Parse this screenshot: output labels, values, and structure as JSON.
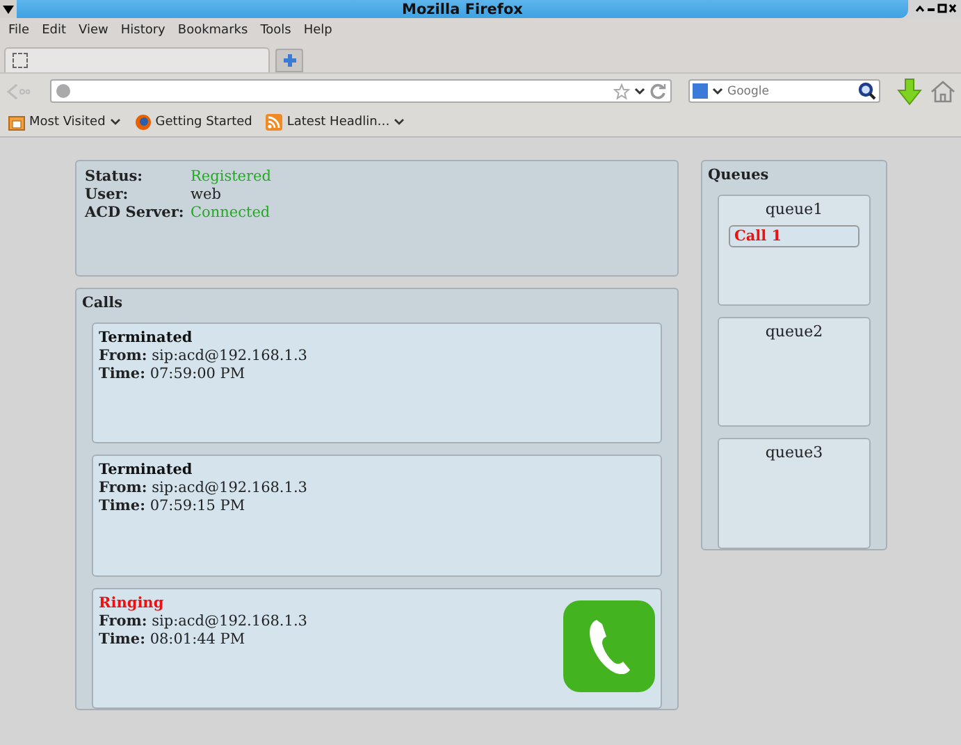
{
  "window": {
    "title": "Mozilla Firefox"
  },
  "menu": [
    "File",
    "Edit",
    "View",
    "History",
    "Bookmarks",
    "Tools",
    "Help"
  ],
  "search": {
    "placeholder": "Google"
  },
  "bookmarks": [
    {
      "label": "Most Visited",
      "kind": "folder"
    },
    {
      "label": "Getting Started",
      "kind": "page"
    },
    {
      "label": "Latest Headlin…",
      "kind": "feed"
    }
  ],
  "status": [
    {
      "label": "Status:",
      "value": "Registered",
      "color": "#22aa22"
    },
    {
      "label": "User:",
      "value": "web",
      "color": "#222222"
    },
    {
      "label": "ACD Server:",
      "value": "Connected",
      "color": "#22aa22"
    }
  ],
  "calls": {
    "title": "Calls",
    "items": [
      {
        "state": "Terminated",
        "kind": "terminated",
        "from_label": "From:",
        "from": "sip:acd@192.168.1.3",
        "time_label": "Time:",
        "time": "07:59:00 PM"
      },
      {
        "state": "Terminated",
        "kind": "terminated",
        "from_label": "From:",
        "from": "sip:acd@192.168.1.3",
        "time_label": "Time:",
        "time": "07:59:15 PM"
      },
      {
        "state": "Ringing",
        "kind": "ringing",
        "from_label": "From:",
        "from": "sip:acd@192.168.1.3",
        "time_label": "Time:",
        "time": "08:01:44 PM"
      }
    ]
  },
  "queues": {
    "title": "Queues",
    "items": [
      {
        "name": "queue1",
        "calls": [
          "Call 1"
        ]
      },
      {
        "name": "queue2"
      },
      {
        "name": "queue3"
      }
    ]
  }
}
